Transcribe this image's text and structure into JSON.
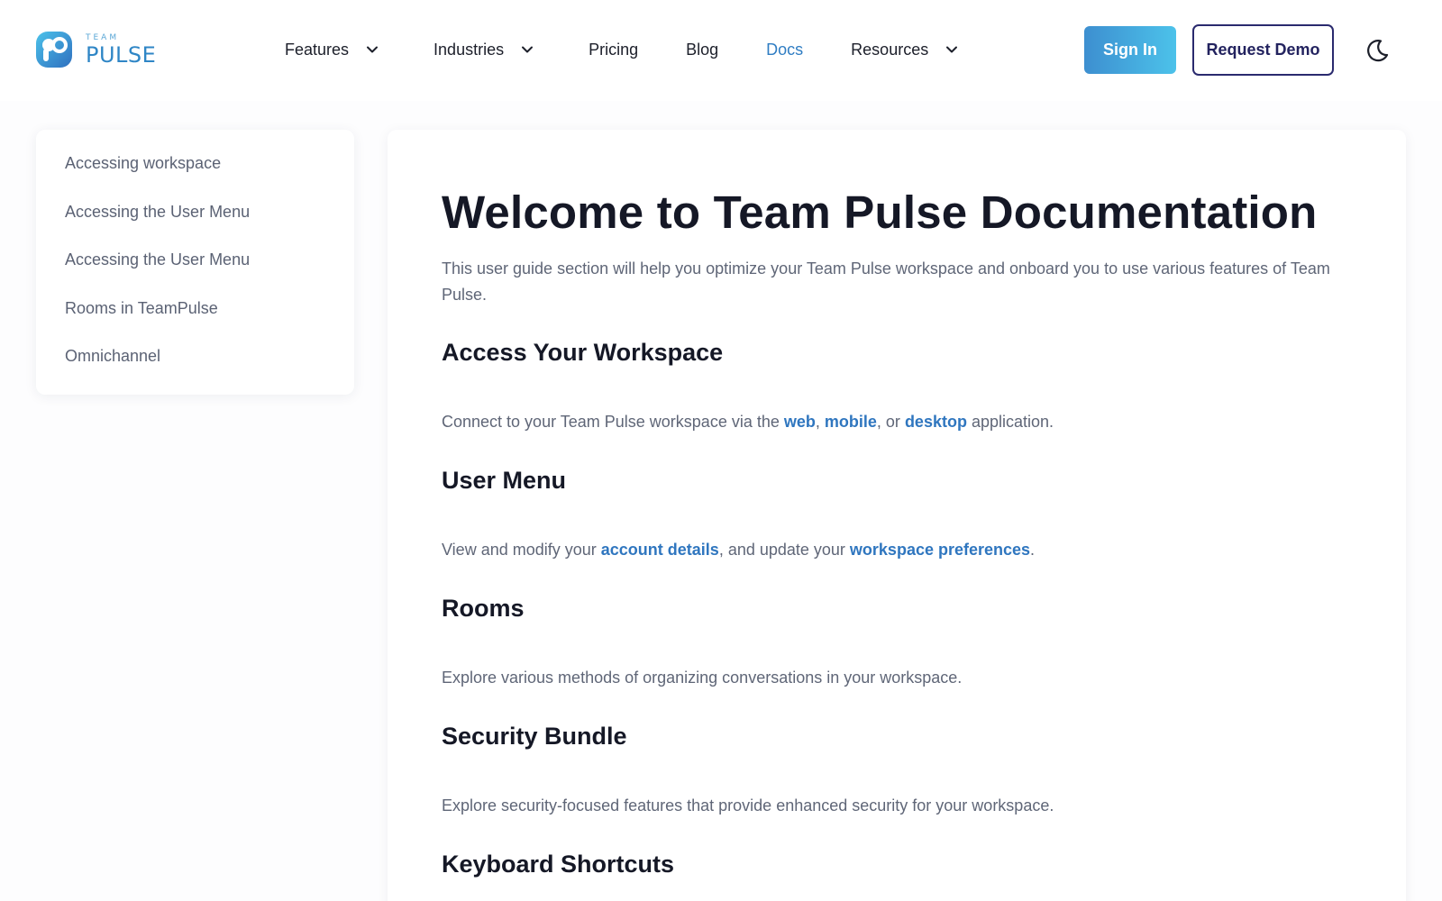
{
  "brand": {
    "small": "TEAM",
    "big": "PULSE",
    "colors": {
      "primary": "#2f86c6",
      "accent": "#4cc2ea",
      "dark": "#23235f"
    }
  },
  "nav": {
    "features": "Features",
    "industries": "Industries",
    "pricing": "Pricing",
    "blog": "Blog",
    "docs": "Docs",
    "resources": "Resources"
  },
  "header": {
    "sign_in": "Sign In",
    "request_demo": "Request Demo",
    "theme_icon": "moon-icon"
  },
  "sidebar": {
    "items": [
      {
        "label": "Accessing workspace"
      },
      {
        "label": "Accessing the User Menu"
      },
      {
        "label": "Accessing the User Menu"
      },
      {
        "label": "Rooms in TeamPulse"
      },
      {
        "label": "Omnichannel"
      }
    ]
  },
  "main": {
    "title": "Welcome to Team Pulse Documentation",
    "intro": "This user guide section will help you optimize your Team Pulse workspace and onboard you to use various features of Team Pulse.",
    "sections": [
      {
        "title": "Access Your Workspace",
        "text_before": "Connect to your Team Pulse workspace via the ",
        "link1": "web",
        "sep1": ", ",
        "link2": "mobile",
        "sep2": ", or ",
        "link3": "desktop",
        "text_after": " application."
      },
      {
        "title": "User Menu",
        "text_before": "View and modify your ",
        "link1": "account details",
        "sep1": ", and update your ",
        "link2": "workspace preferences",
        "text_after": "."
      },
      {
        "title": "Rooms",
        "text": "Explore various methods of organizing conversations in your workspace."
      },
      {
        "title": "Security Bundle",
        "text": "Explore security-focused features that provide enhanced security for your workspace."
      },
      {
        "title": "Keyboard Shortcuts"
      }
    ]
  }
}
